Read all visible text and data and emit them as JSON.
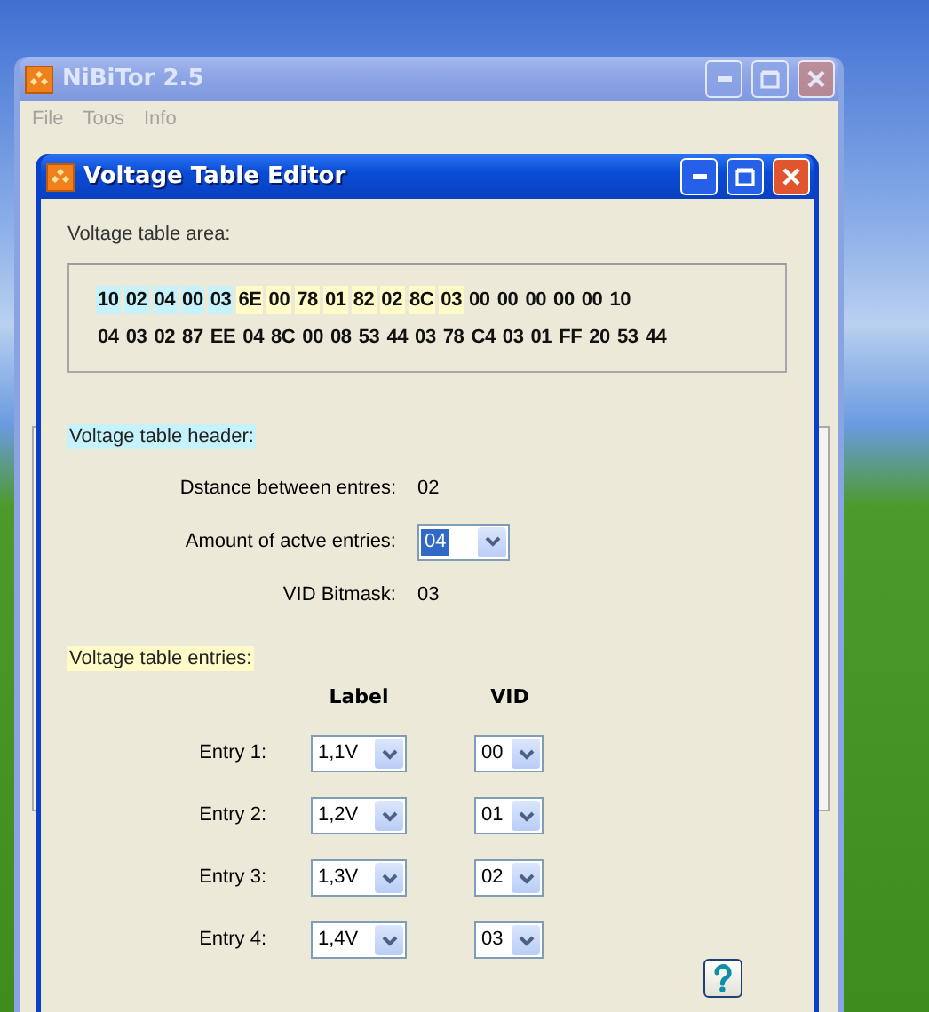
{
  "main_window": {
    "title": "NiBiTor 2.5",
    "active": false,
    "menu": [
      "File",
      "Toos",
      "Info"
    ]
  },
  "dialog": {
    "title": "Voltage Table Editor",
    "active": true,
    "area_label": "Voltage table area:",
    "hex_rows": [
      [
        {
          "text": "10",
          "kind": "header"
        },
        {
          "text": "02",
          "kind": "header"
        },
        {
          "text": "04",
          "kind": "header"
        },
        {
          "text": "00",
          "kind": "header"
        },
        {
          "text": "03",
          "kind": "header"
        },
        {
          "text": "6E",
          "kind": "entries"
        },
        {
          "text": "00",
          "kind": "entries"
        },
        {
          "text": "78",
          "kind": "entries"
        },
        {
          "text": "01",
          "kind": "entries"
        },
        {
          "text": "82",
          "kind": "entries"
        },
        {
          "text": "02",
          "kind": "entries"
        },
        {
          "text": "8C",
          "kind": "entries"
        },
        {
          "text": "03",
          "kind": "entries"
        },
        {
          "text": "00",
          "kind": "plain"
        },
        {
          "text": "00",
          "kind": "plain"
        },
        {
          "text": "00",
          "kind": "plain"
        },
        {
          "text": "00",
          "kind": "plain"
        },
        {
          "text": "00",
          "kind": "plain"
        },
        {
          "text": "10",
          "kind": "plain"
        }
      ],
      [
        {
          "text": "04",
          "kind": "plain"
        },
        {
          "text": "03",
          "kind": "plain"
        },
        {
          "text": "02",
          "kind": "plain"
        },
        {
          "text": "87",
          "kind": "plain"
        },
        {
          "text": "EE",
          "kind": "plain"
        },
        {
          "text": "04",
          "kind": "plain"
        },
        {
          "text": "8C",
          "kind": "plain"
        },
        {
          "text": "00",
          "kind": "plain"
        },
        {
          "text": "08",
          "kind": "plain"
        },
        {
          "text": "53",
          "kind": "plain"
        },
        {
          "text": "44",
          "kind": "plain"
        },
        {
          "text": "03",
          "kind": "plain"
        },
        {
          "text": "78",
          "kind": "plain"
        },
        {
          "text": "C4",
          "kind": "plain"
        },
        {
          "text": "03",
          "kind": "plain"
        },
        {
          "text": "01",
          "kind": "plain"
        },
        {
          "text": "FF",
          "kind": "plain"
        },
        {
          "text": "20",
          "kind": "plain"
        },
        {
          "text": "53",
          "kind": "plain"
        },
        {
          "text": "44",
          "kind": "plain"
        }
      ]
    ],
    "header_section": {
      "title": "Voltage table header:",
      "kind": "header",
      "fields": [
        {
          "label": "Dstance between entres:",
          "kind": "text",
          "value": "02"
        },
        {
          "label": "Amount of actve entries:",
          "kind": "combo",
          "value": "04",
          "focused": true
        },
        {
          "label": "VID Bitmask:",
          "kind": "text",
          "value": "03"
        }
      ]
    },
    "entries_section": {
      "title": "Voltage table entries:",
      "kind": "entries",
      "columns": [
        "Label",
        "VID"
      ],
      "rows": [
        {
          "label": "Entry 1:",
          "voltage": "1,1V",
          "vid": "00"
        },
        {
          "label": "Entry 2:",
          "voltage": "1,2V",
          "vid": "01"
        },
        {
          "label": "Entry 3:",
          "voltage": "1,3V",
          "vid": "02"
        },
        {
          "label": "Entry 4:",
          "voltage": "1,4V",
          "vid": "03"
        }
      ]
    }
  }
}
